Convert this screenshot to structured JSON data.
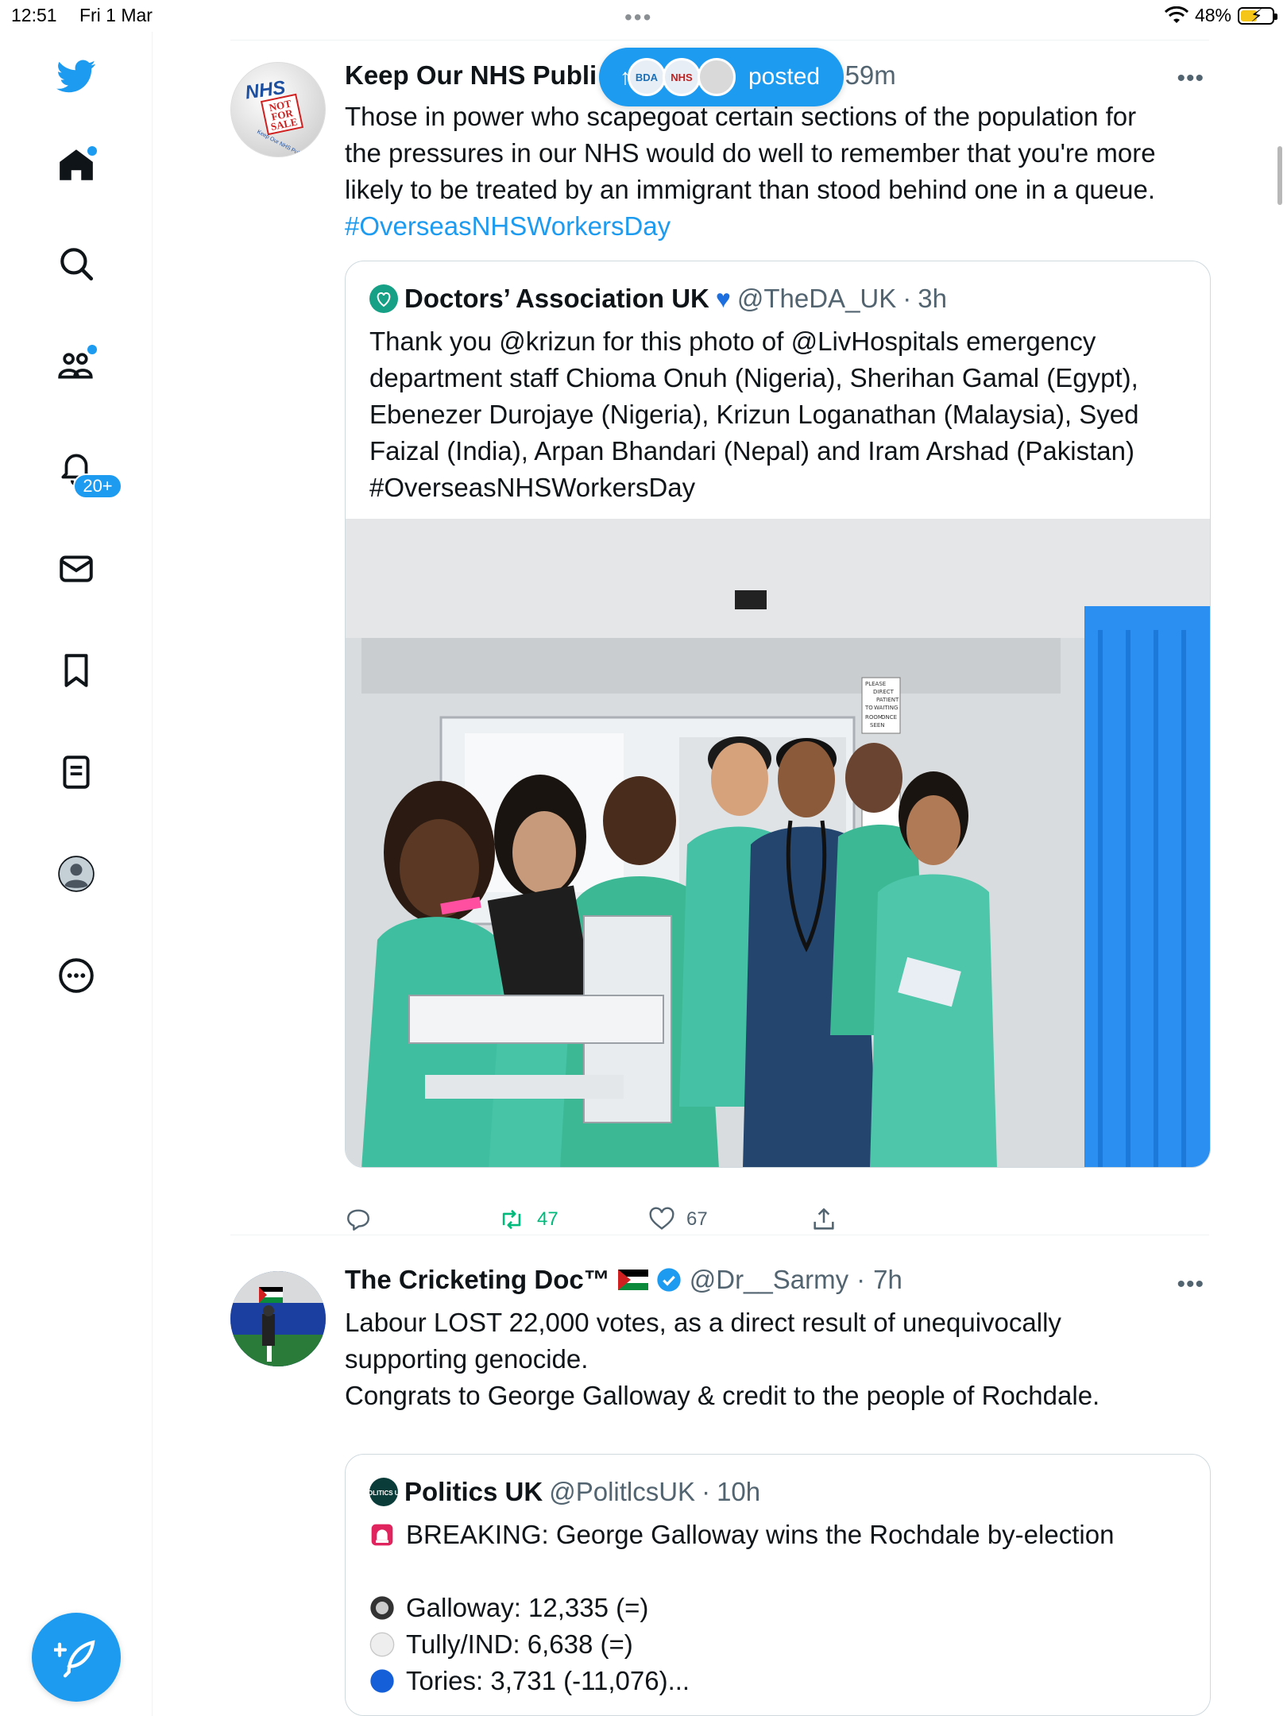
{
  "status": {
    "time": "12:51",
    "date": "Fri 1 Mar",
    "battery": "48%"
  },
  "sidebar": {
    "notifications_badge": "20+"
  },
  "new_posts_pill": {
    "label": "posted",
    "avatar_labels": [
      "BDA",
      "NHS"
    ]
  },
  "tweets": [
    {
      "name": "Keep Our NHS Publi",
      "time_fragment": "59m",
      "text_lines": [
        "Those in power who scapegoat certain sections of the population for",
        "the pressures in our NHS would do well to remember that you're more",
        "likely to be treated by an immigrant than stood behind one in a queue."
      ],
      "hashtag": "#OverseasNHSWorkersDay",
      "avatar_text": [
        "NHS",
        "NOT",
        "FOR",
        "SALE",
        "Keep Our NHS Public"
      ],
      "quote": {
        "name": "Doctors’ Association UK",
        "handle": "@TheDA_UK",
        "time": "3h",
        "text_lines": [
          "Thank you @krizun for this photo of @LivHospitals emergency",
          "department staff Chioma Onuh (Nigeria), Sherihan Gamal (Egypt),",
          "Ebenezer Durojaye (Nigeria), Krizun Loganathan (Malaysia), Syed",
          "Faizal (India), Arpan Bhandari (Nepal) and Iram Arshad (Pakistan)",
          "#OverseasNHSWorkersDay"
        ],
        "photo_sign": [
          "PLEASE",
          "DIRECT",
          "PATIENT",
          "TO",
          "WAITING",
          "ROOM",
          "ONCE",
          "SEEN"
        ]
      },
      "actions": {
        "retweets": "47",
        "likes": "67"
      }
    },
    {
      "name": "The Cricketing Doc™",
      "handle": "@Dr__Sarmy",
      "time": "7h",
      "text_lines": [
        "Labour LOST 22,000 votes, as a direct result of unequivocally",
        "supporting genocide.",
        "Congrats to George Galloway & credit to the people of Rochdale."
      ],
      "quote": {
        "name": "Politics UK",
        "handle": "@PolitlcsUK",
        "time": "10h",
        "avatar_text": "POLITICS UK",
        "lines": [
          "BREAKING: George Galloway wins the Rochdale by-election",
          "Galloway: 12,335 (=)",
          "Tully/IND: 6,638 (=)",
          "Tories: 3,731 (-11,076)..."
        ]
      }
    }
  ],
  "colors": {
    "accent": "#1d9bf0",
    "text": "#0f1419",
    "muted": "#536471",
    "retweet": "#00ba7c"
  }
}
